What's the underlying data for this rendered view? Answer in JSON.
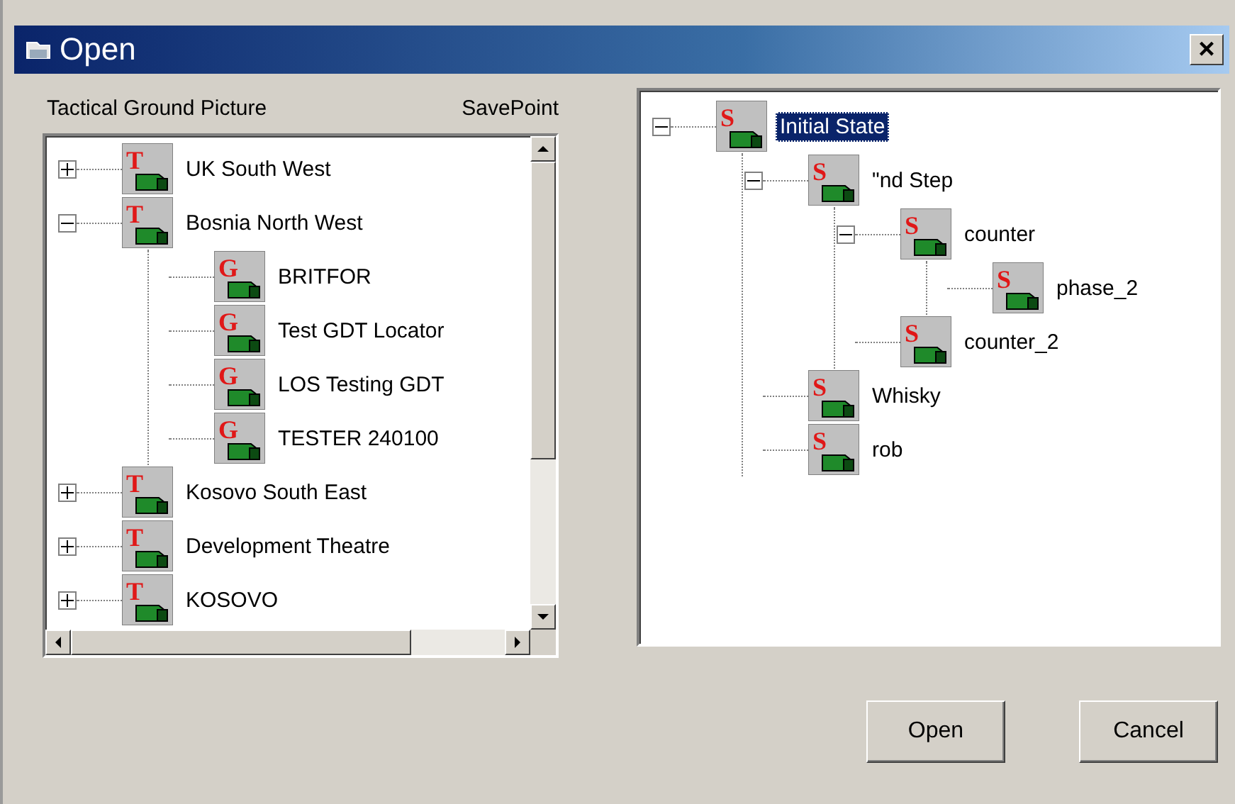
{
  "window": {
    "title": "Open",
    "close": "×"
  },
  "left_panel": {
    "label": "Tactical Ground Picture",
    "column_label": "SavePoint",
    "tree": [
      {
        "label": "UK South West",
        "icon_letter": "T",
        "expanded": false,
        "selected": false
      },
      {
        "label": "Bosnia North West",
        "icon_letter": "T",
        "expanded": true,
        "selected": false,
        "children": [
          {
            "label": "BRITFOR",
            "icon_letter": "G",
            "selected": false
          },
          {
            "label": "Test GDT Locator",
            "icon_letter": "G",
            "selected": false
          },
          {
            "label": "LOS Testing GDT",
            "icon_letter": "G",
            "selected": false
          },
          {
            "label": "TESTER 240100",
            "icon_letter": "G",
            "selected": false
          }
        ]
      },
      {
        "label": "Kosovo South East",
        "icon_letter": "T",
        "expanded": false,
        "selected": false
      },
      {
        "label": "Development Theatre",
        "icon_letter": "T",
        "expanded": false,
        "selected": false
      },
      {
        "label": "KOSOVO",
        "icon_letter": "T",
        "expanded": false,
        "selected": false
      }
    ]
  },
  "right_panel": {
    "tree": [
      {
        "label": "Initial State",
        "icon_letter": "S",
        "expanded": true,
        "selected": true,
        "children": [
          {
            "label": "\"nd Step",
            "icon_letter": "S",
            "expanded": true,
            "selected": false,
            "children": [
              {
                "label": "counter",
                "icon_letter": "S",
                "expanded": true,
                "selected": false,
                "children": [
                  {
                    "label": "phase_2",
                    "icon_letter": "S",
                    "selected": false
                  }
                ]
              },
              {
                "label": "counter_2",
                "icon_letter": "S",
                "selected": false
              }
            ]
          },
          {
            "label": "Whisky",
            "icon_letter": "S",
            "selected": false
          },
          {
            "label": "rob",
            "icon_letter": "S",
            "selected": false
          }
        ]
      }
    ]
  },
  "buttons": [
    {
      "label": "Open"
    },
    {
      "label": "Cancel"
    }
  ]
}
